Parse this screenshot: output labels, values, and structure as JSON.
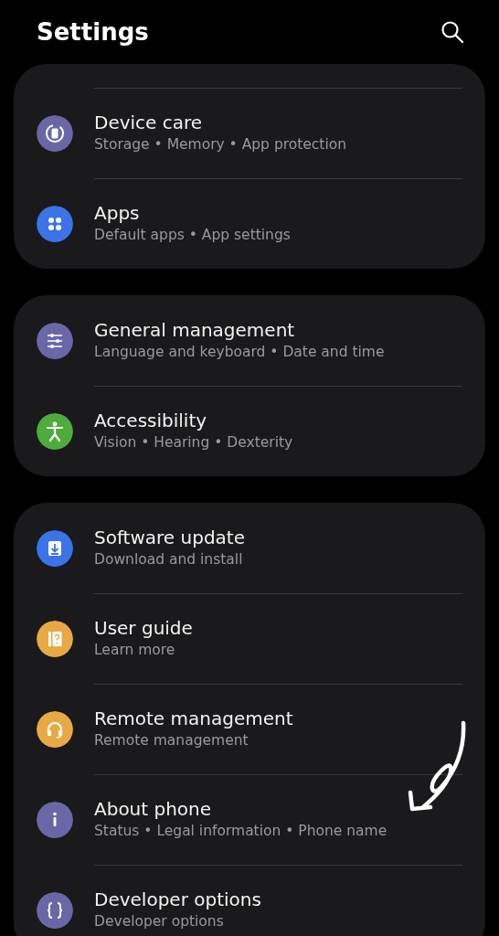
{
  "header": {
    "title": "Settings"
  },
  "groups": [
    {
      "items": [
        {
          "title": "Device care",
          "subtitle": "Storage • Memory • App protection",
          "kind": "device-care",
          "color": "#6b67a6"
        },
        {
          "title": "Apps",
          "subtitle": "Default apps • App settings",
          "kind": "apps",
          "color": "#3a74e6"
        }
      ]
    },
    {
      "items": [
        {
          "title": "General management",
          "subtitle": "Language and keyboard • Date and time",
          "kind": "sliders",
          "color": "#6b67a6"
        },
        {
          "title": "Accessibility",
          "subtitle": "Vision • Hearing • Dexterity",
          "kind": "accessibility",
          "color": "#4fab3c"
        }
      ]
    },
    {
      "items": [
        {
          "title": "Software update",
          "subtitle": "Download and install",
          "kind": "download",
          "color": "#3a74e6"
        },
        {
          "title": "User guide",
          "subtitle": "Learn more",
          "kind": "guide",
          "color": "#e8a945"
        },
        {
          "title": "Remote management",
          "subtitle": "Remote management",
          "kind": "headset",
          "color": "#e8a945"
        },
        {
          "title": "About phone",
          "subtitle": "Status • Legal information • Phone name",
          "kind": "info",
          "color": "#6b67a6"
        },
        {
          "title": "Developer options",
          "subtitle": "Developer options",
          "kind": "braces",
          "color": "#6b67a6"
        }
      ]
    }
  ]
}
